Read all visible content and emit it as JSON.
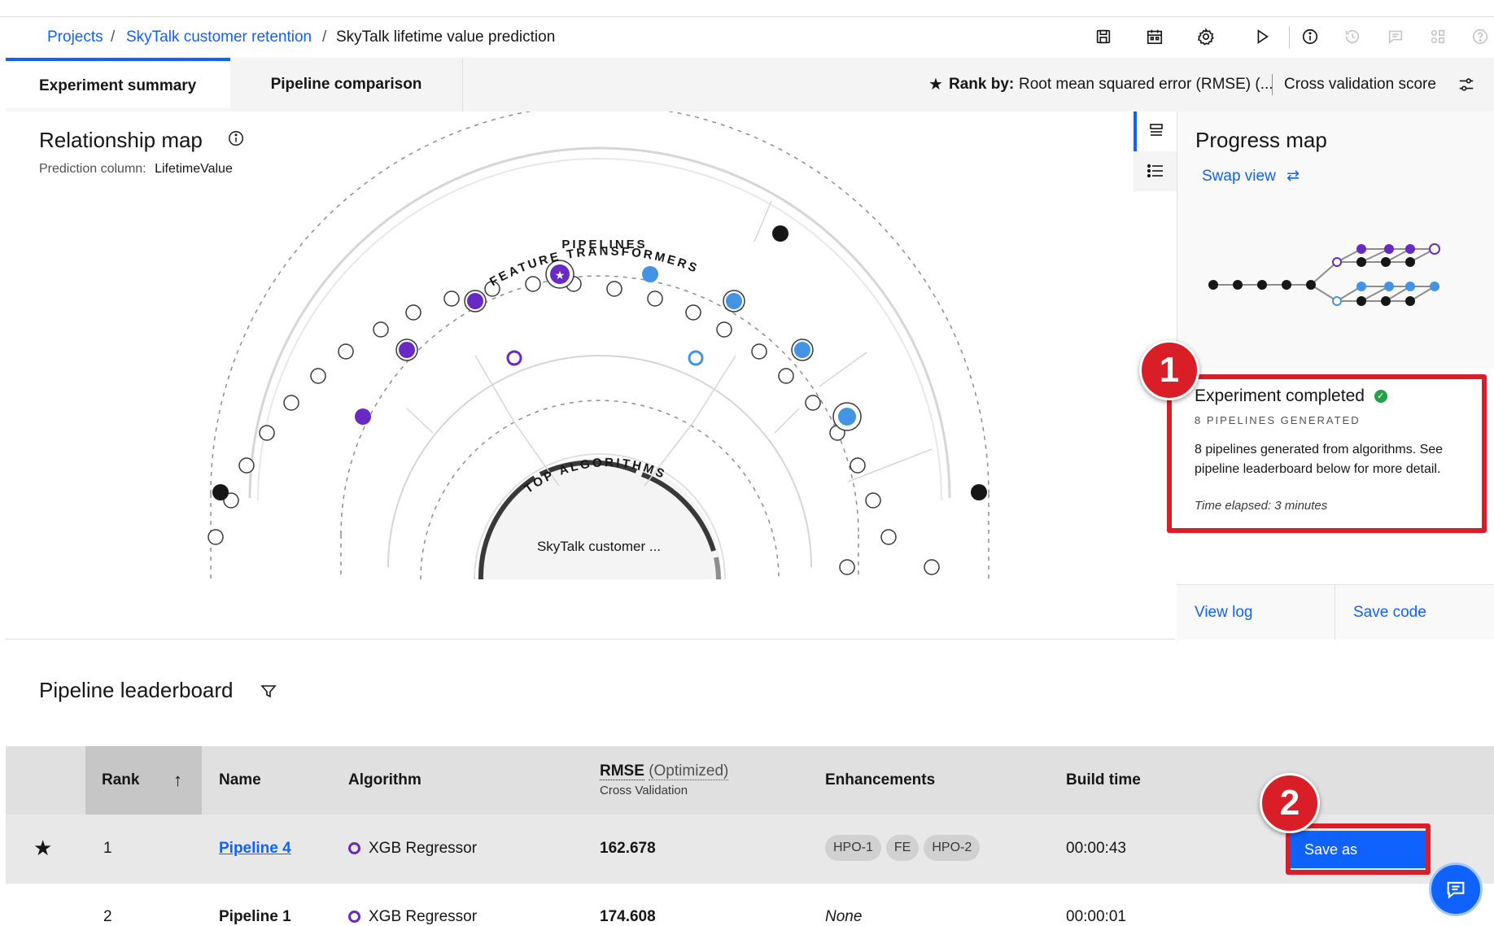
{
  "breadcrumb": {
    "items": [
      "Projects",
      "SkyTalk customer retention",
      "SkyTalk lifetime value prediction"
    ],
    "separator": "/"
  },
  "toolbar": {
    "icons": [
      "save-icon",
      "calendar-icon",
      "gear-icon",
      "play-icon",
      "info-icon",
      "history-icon",
      "comment-icon",
      "data-icon",
      "help-icon"
    ]
  },
  "tabs": {
    "summary": "Experiment summary",
    "comparison": "Pipeline comparison"
  },
  "rank_by": {
    "label": "Rank by:",
    "value": "Root mean squared error (RMSE) (...",
    "score": "Cross validation score"
  },
  "relationship_map": {
    "title": "Relationship map",
    "prediction_label": "Prediction column:",
    "prediction_value": "LifetimeValue",
    "ring_feature": "FEATURE TRANSFORMERS",
    "ring_pipelines": "PIPELINES",
    "ring_algorithms": "TOP ALGORITHMS",
    "center_label": "SkyTalk customer ..."
  },
  "progress_map": {
    "title": "Progress map",
    "swap_view": "Swap view",
    "status_title": "Experiment completed",
    "pipelines_generated": "8 PIPELINES GENERATED",
    "description": "8 pipelines generated from algorithms. See pipeline leaderboard below for more detail.",
    "time_elapsed": "Time elapsed: 3 minutes",
    "view_log": "View log",
    "save_code": "Save code"
  },
  "annotations": {
    "badge1": "1",
    "badge2": "2"
  },
  "leaderboard": {
    "title": "Pipeline leaderboard",
    "columns": {
      "rank": "Rank",
      "name": "Name",
      "algorithm": "Algorithm",
      "rmse": "RMSE",
      "rmse_suffix": "(Optimized)",
      "rmse_sub": "Cross Validation",
      "enhancements": "Enhancements",
      "build_time": "Build time"
    },
    "rows": [
      {
        "rank": "1",
        "name": "Pipeline 4",
        "algorithm": "XGB Regressor",
        "rmse": "162.678",
        "enhancements": [
          "HPO-1",
          "FE",
          "HPO-2"
        ],
        "build_time": "00:00:43",
        "action": "Save as"
      },
      {
        "rank": "2",
        "name": "Pipeline 1",
        "algorithm": "XGB Regressor",
        "rmse": "174.608",
        "enhancements_text": "None",
        "build_time": "00:00:01"
      }
    ]
  },
  "colors": {
    "primary": "#0f62fe",
    "purple": "#6929c4",
    "blue": "#4394e5",
    "success": "#24a148",
    "annotation_red": "#da1e28"
  }
}
